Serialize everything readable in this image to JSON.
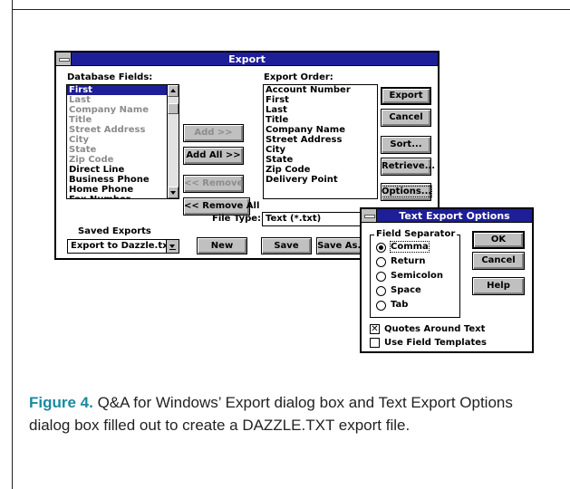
{
  "export_dialog": {
    "title": "Export",
    "db_fields_label": "Database Fields:",
    "db_fields": [
      {
        "label": "First",
        "state": "selected"
      },
      {
        "label": "Last",
        "state": "dim"
      },
      {
        "label": "Company Name",
        "state": "dim"
      },
      {
        "label": "Title",
        "state": "dim"
      },
      {
        "label": "Street Address",
        "state": "dim"
      },
      {
        "label": "City",
        "state": "dim"
      },
      {
        "label": "State",
        "state": "dim"
      },
      {
        "label": "Zip Code",
        "state": "dim"
      },
      {
        "label": "Direct Line",
        "state": "normal"
      },
      {
        "label": "Business Phone",
        "state": "normal"
      },
      {
        "label": "Home Phone",
        "state": "normal"
      },
      {
        "label": "Fax Number",
        "state": "normal"
      }
    ],
    "add_label": "Add >>",
    "add_all_label": "Add All >>",
    "remove_label": "<< Remove",
    "remove_all_label": "<< Remove All",
    "export_order_label": "Export Order:",
    "export_order": [
      "Account Number",
      "First",
      "Last",
      "Title",
      "Company Name",
      "Street Address",
      "City",
      "State",
      "Zip Code",
      "Delivery Point"
    ],
    "export_btn": "Export",
    "cancel_btn": "Cancel",
    "sort_btn": "Sort...",
    "retrieve_btn": "Retrieve...",
    "options_btn": "Options...",
    "file_type_label": "File Type:",
    "file_type_value": "Text   (*.txt)",
    "saved_exports_label": "Saved Exports",
    "saved_exports_value": "Export to Dazzle.txt",
    "new_btn": "New",
    "save_btn": "Save",
    "save_as_btn": "Save As..."
  },
  "options_dialog": {
    "title": "Text Export Options",
    "separator_label": "Field Separator",
    "separators": [
      {
        "label": "Comma",
        "checked": true
      },
      {
        "label": "Return",
        "checked": false
      },
      {
        "label": "Semicolon",
        "checked": false
      },
      {
        "label": "Space",
        "checked": false
      },
      {
        "label": "Tab",
        "checked": false
      }
    ],
    "ok_btn": "OK",
    "cancel_btn": "Cancel",
    "help_btn": "Help",
    "quotes_label": "Quotes Around Text",
    "quotes_checked": true,
    "templates_label": "Use Field Templates",
    "templates_checked": false
  },
  "caption": {
    "figure_label": "Figure 4.",
    "text": " Q&A for Windows’ Export dialog box and Text Export Options dialog box filled out to create a DAZZLE.TXT export file."
  },
  "colors": {
    "titlebar": "#1e1e98",
    "caption_accent": "#1a8aa0",
    "button_face": "#c0c0c0"
  }
}
